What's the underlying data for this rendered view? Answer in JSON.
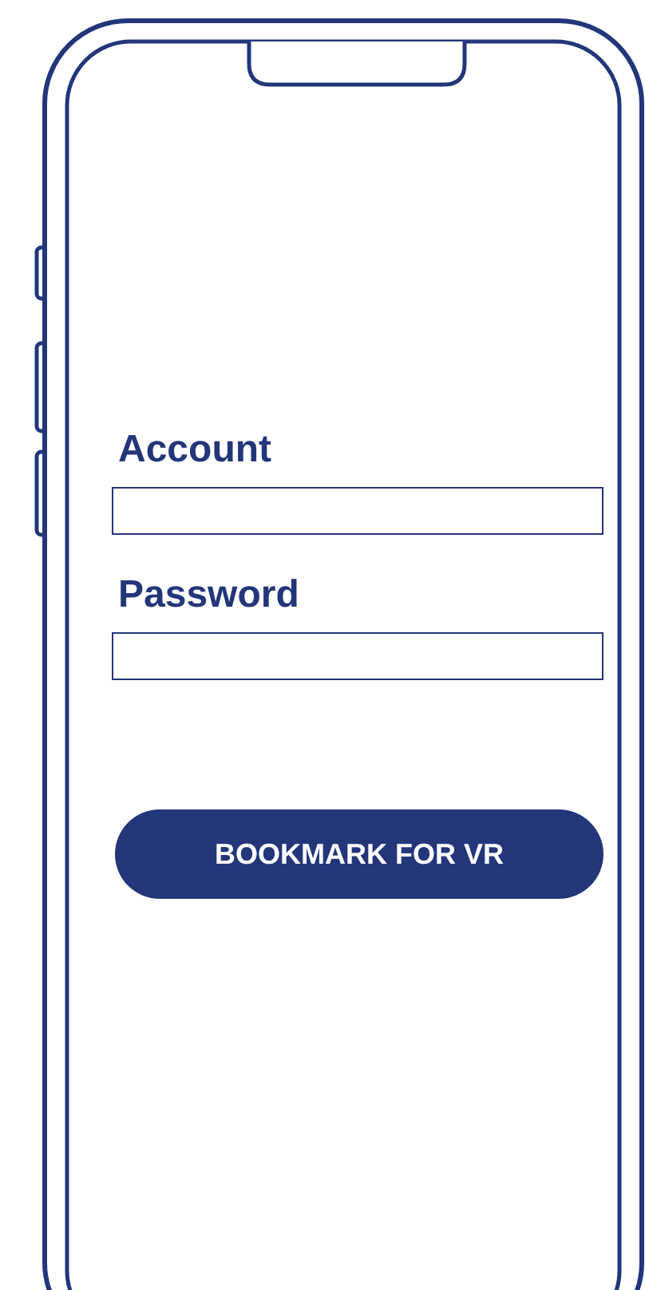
{
  "form": {
    "fields": [
      {
        "label": "Account"
      },
      {
        "label": "Password"
      }
    ]
  },
  "button": {
    "label": "BOOKMARK FOR VR"
  }
}
